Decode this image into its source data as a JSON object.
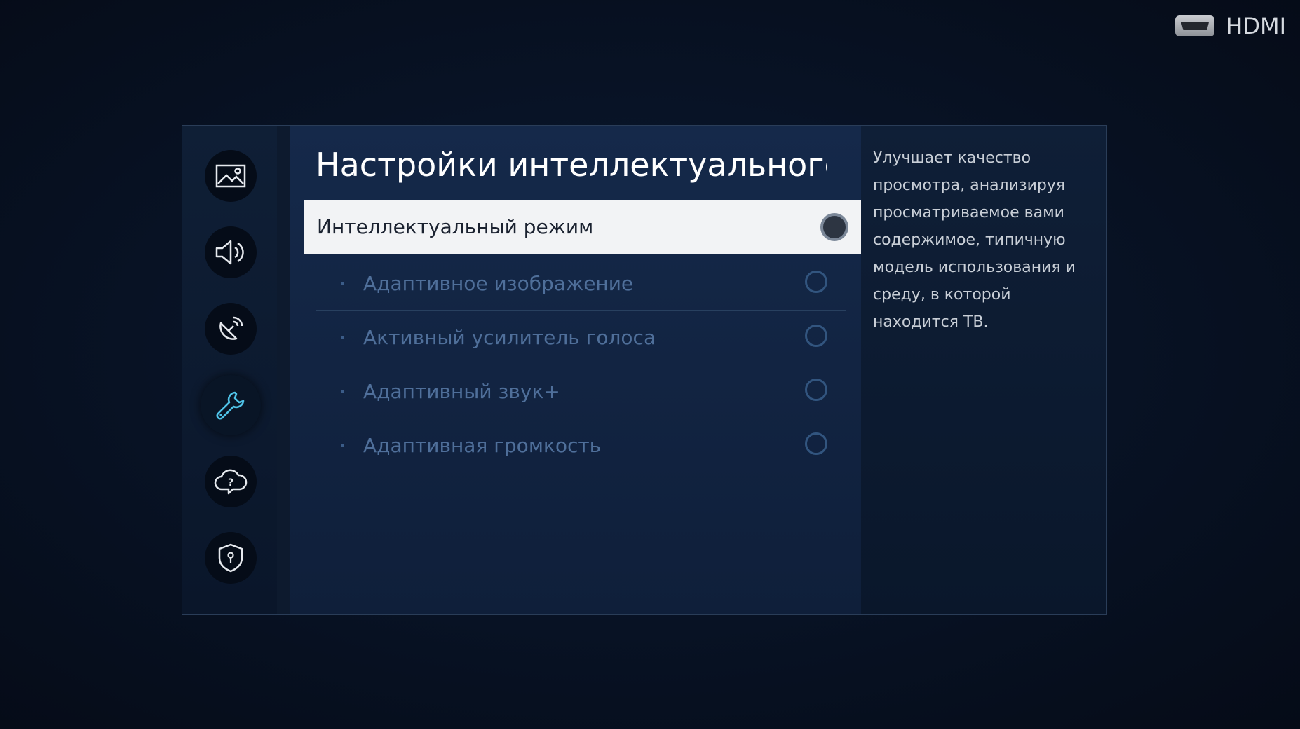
{
  "source": {
    "label": "HDMI",
    "icon": "hdmi-port-icon"
  },
  "sidebar": {
    "items": [
      {
        "name": "picture",
        "icon": "picture-icon"
      },
      {
        "name": "sound",
        "icon": "sound-icon"
      },
      {
        "name": "broadcast",
        "icon": "satellite-dish-icon"
      },
      {
        "name": "general",
        "icon": "wrench-icon",
        "active": true
      },
      {
        "name": "support",
        "icon": "cloud-question-icon"
      },
      {
        "name": "privacy",
        "icon": "shield-icon"
      }
    ]
  },
  "main": {
    "title": "Настройки интеллектуального р",
    "options": [
      {
        "label": "Интеллектуальный режим",
        "selected": true,
        "checked": false
      },
      {
        "label": "Адаптивное изображение",
        "checked": false
      },
      {
        "label": "Активный усилитель голоса",
        "checked": false
      },
      {
        "label": "Адаптивный звук+",
        "checked": false
      },
      {
        "label": "Адаптивная громкость",
        "checked": false
      }
    ]
  },
  "help": {
    "text": "Улучшает качество просмотра, анализируя просматриваемое вами содержимое, типичную модель использования и среду, в которой находится ТВ."
  },
  "colors": {
    "accent": "#4fc3e8",
    "selected_row": "#f2f3f5",
    "disabled_text": "#4f6f9a"
  }
}
